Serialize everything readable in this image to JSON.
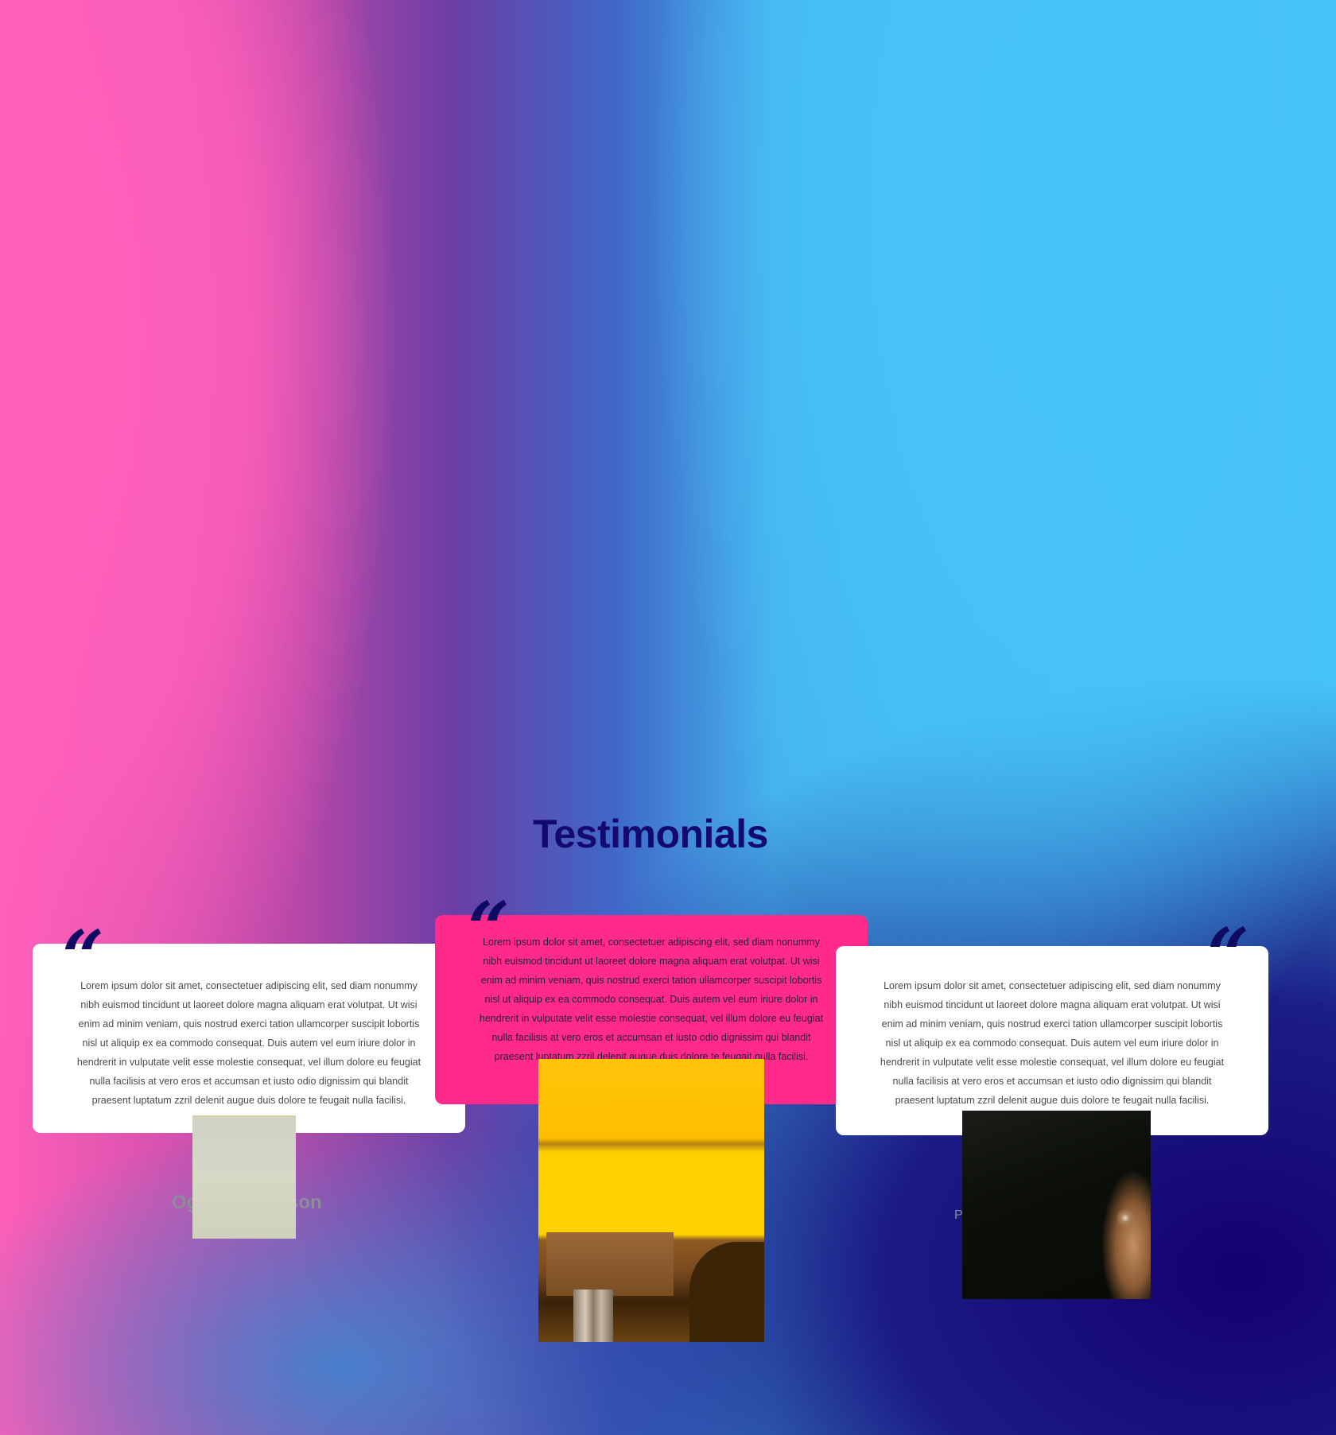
{
  "section": {
    "title": "Testimonials"
  },
  "testimonials": [
    {
      "quote_mark": "“",
      "text": "Lorem ipsum dolor sit amet, consectetuer adipiscing elit, sed diam nonummy nibh euismod tincidunt ut laoreet dolore magna aliquam erat volutpat. Ut wisi enim ad minim veniam, quis nostrud exerci tation ullamcorper suscipit lobortis nisl ut aliquip ex ea commodo consequat. Duis autem vel eum iriure dolor in hendrerit in vulputate velit esse molestie consequat, vel illum dolore eu feugiat nulla facilisis at vero eros et accumsan et iusto odio dignissim qui blandit praesent luptatum zzril delenit augue duis dolore te feugait nulla facilisi.",
      "name_left": "Og",
      "name_right": "son"
    },
    {
      "quote_mark": "“",
      "text": "Lorem ipsum dolor sit amet, consectetuer adipiscing elit, sed diam nonummy nibh euismod tincidunt ut laoreet dolore magna aliquam erat volutpat. Ut wisi enim ad minim veniam, quis nostrud exerci tation ullamcorper suscipit lobortis nisl ut aliquip ex ea commodo consequat. Duis autem vel eum iriure dolor in hendrerit in vulputate velit esse molestie consequat, vel illum dolore eu feugiat nulla facilisis at vero eros et accumsan et iusto odio dignissim qui blandit praesent luptatum zzril delenit augue duis dolore te feugait nulla facilisi."
    },
    {
      "quote_mark": "“",
      "text": "Lorem ipsum dolor sit amet, consectetuer adipiscing elit, sed diam nonummy nibh euismod tincidunt ut laoreet dolore magna aliquam erat volutpat. Ut wisi enim ad minim veniam, quis nostrud exerci tation ullamcorper suscipit lobortis nisl ut aliquip ex ea commodo consequat. Duis autem vel eum iriure dolor in hendrerit in vulputate velit esse molestie consequat, vel illum dolore eu feugiat nulla facilisis at vero eros et accumsan et iusto odio dignissim qui blandit praesent luptatum zzril delenit augue duis dolore te feugait nulla facilisi.",
      "role_fragment": "P"
    }
  ],
  "colors": {
    "heading": "#14096e",
    "quote_mark": "#0f0b63",
    "card": "#ffffff",
    "card_featured": "#ff2a8a",
    "gradient_pink": "#ff5fb8",
    "gradient_blue": "#46c3f8",
    "gradient_navy": "#140070"
  }
}
